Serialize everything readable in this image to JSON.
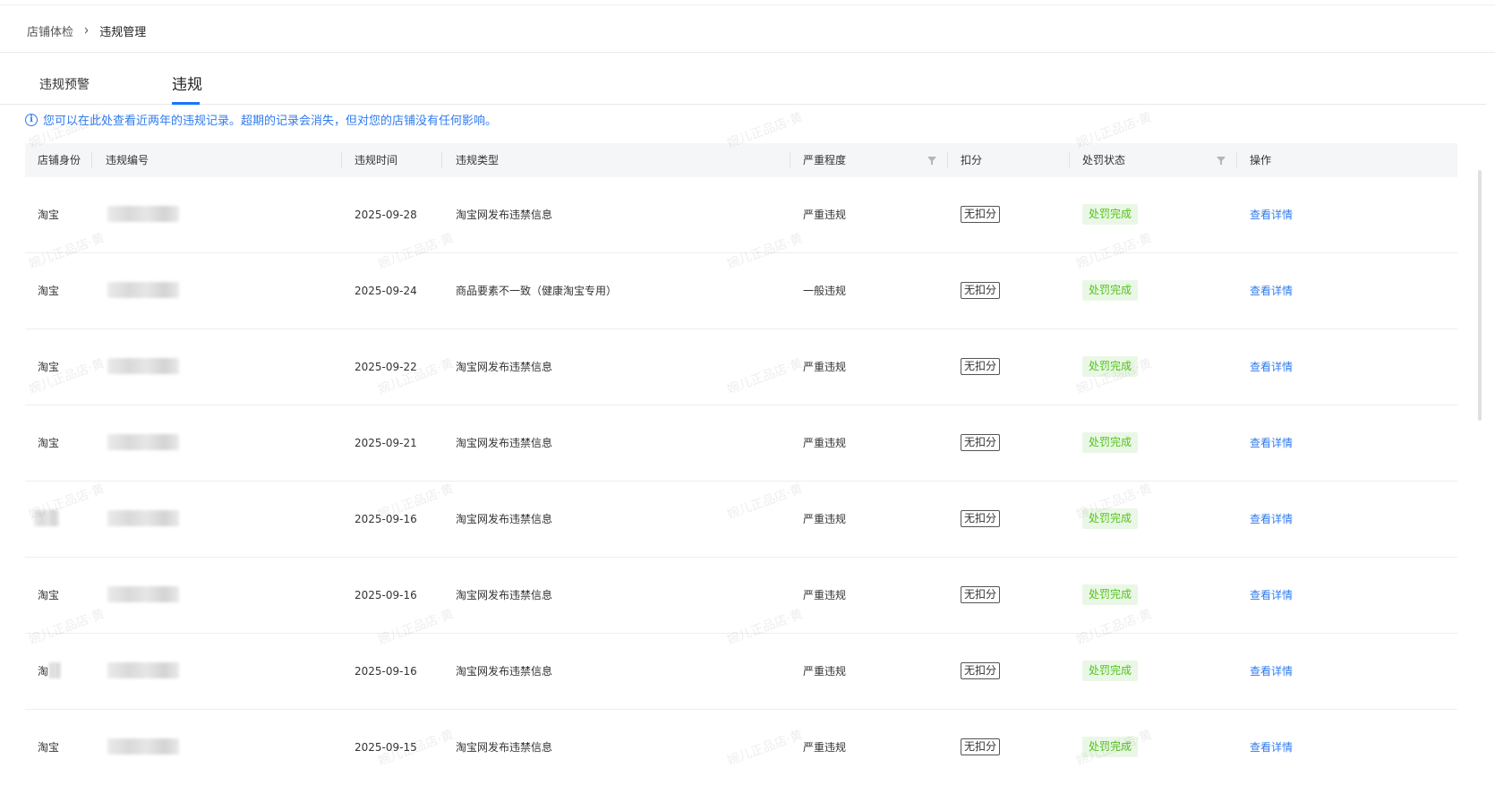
{
  "breadcrumb": {
    "parent": "店铺体检",
    "separator": "›",
    "current": "违规管理"
  },
  "tabs": [
    {
      "label": "违规预警",
      "active": false
    },
    {
      "label": "违规",
      "active": true
    }
  ],
  "notice": {
    "icon": "info-icon",
    "text": "您可以在此处查看近两年的违规记录。超期的记录会消失，但对您的店铺没有任何影响。"
  },
  "table": {
    "headers": {
      "identity": "店铺身份",
      "code": "违规编号",
      "time": "违规时间",
      "type": "违规类型",
      "severity": "严重程度",
      "deduct": "扣分",
      "status": "处罚状态",
      "action": "操作"
    },
    "rows": [
      {
        "identity": "淘宝",
        "time": "2025-09-28",
        "type": "淘宝网发布违禁信息",
        "severity": "严重违规",
        "deduct": "无扣分",
        "status": "处罚完成",
        "action": "查看详情"
      },
      {
        "identity": "淘宝",
        "time": "2025-09-24",
        "type": "商品要素不一致（健康淘宝专用）",
        "severity": "一般违规",
        "deduct": "无扣分",
        "status": "处罚完成",
        "action": "查看详情"
      },
      {
        "identity": "淘宝",
        "time": "2025-09-22",
        "type": "淘宝网发布违禁信息",
        "severity": "严重违规",
        "deduct": "无扣分",
        "status": "处罚完成",
        "action": "查看详情"
      },
      {
        "identity": "淘宝",
        "time": "2025-09-21",
        "type": "淘宝网发布违禁信息",
        "severity": "严重违规",
        "deduct": "无扣分",
        "status": "处罚完成",
        "action": "查看详情"
      },
      {
        "identity": "",
        "time": "2025-09-16",
        "type": "淘宝网发布违禁信息",
        "severity": "严重违规",
        "deduct": "无扣分",
        "status": "处罚完成",
        "action": "查看详情"
      },
      {
        "identity": "淘宝",
        "time": "2025-09-16",
        "type": "淘宝网发布违禁信息",
        "severity": "严重违规",
        "deduct": "无扣分",
        "status": "处罚完成",
        "action": "查看详情"
      },
      {
        "identity": "淘",
        "time": "2025-09-16",
        "type": "淘宝网发布违禁信息",
        "severity": "严重违规",
        "deduct": "无扣分",
        "status": "处罚完成",
        "action": "查看详情"
      },
      {
        "identity": "淘宝",
        "time": "2025-09-15",
        "type": "淘宝网发布违禁信息",
        "severity": "严重违规",
        "deduct": "无扣分",
        "status": "处罚完成",
        "action": "查看详情"
      }
    ]
  },
  "watermark": "婉儿正品店·黄",
  "colors": {
    "link": "#2f7bef",
    "success_text": "#52c41a",
    "success_bg": "#eaf7e6",
    "header_bg": "#f5f6f8",
    "tab_ink": "#1677ff"
  }
}
